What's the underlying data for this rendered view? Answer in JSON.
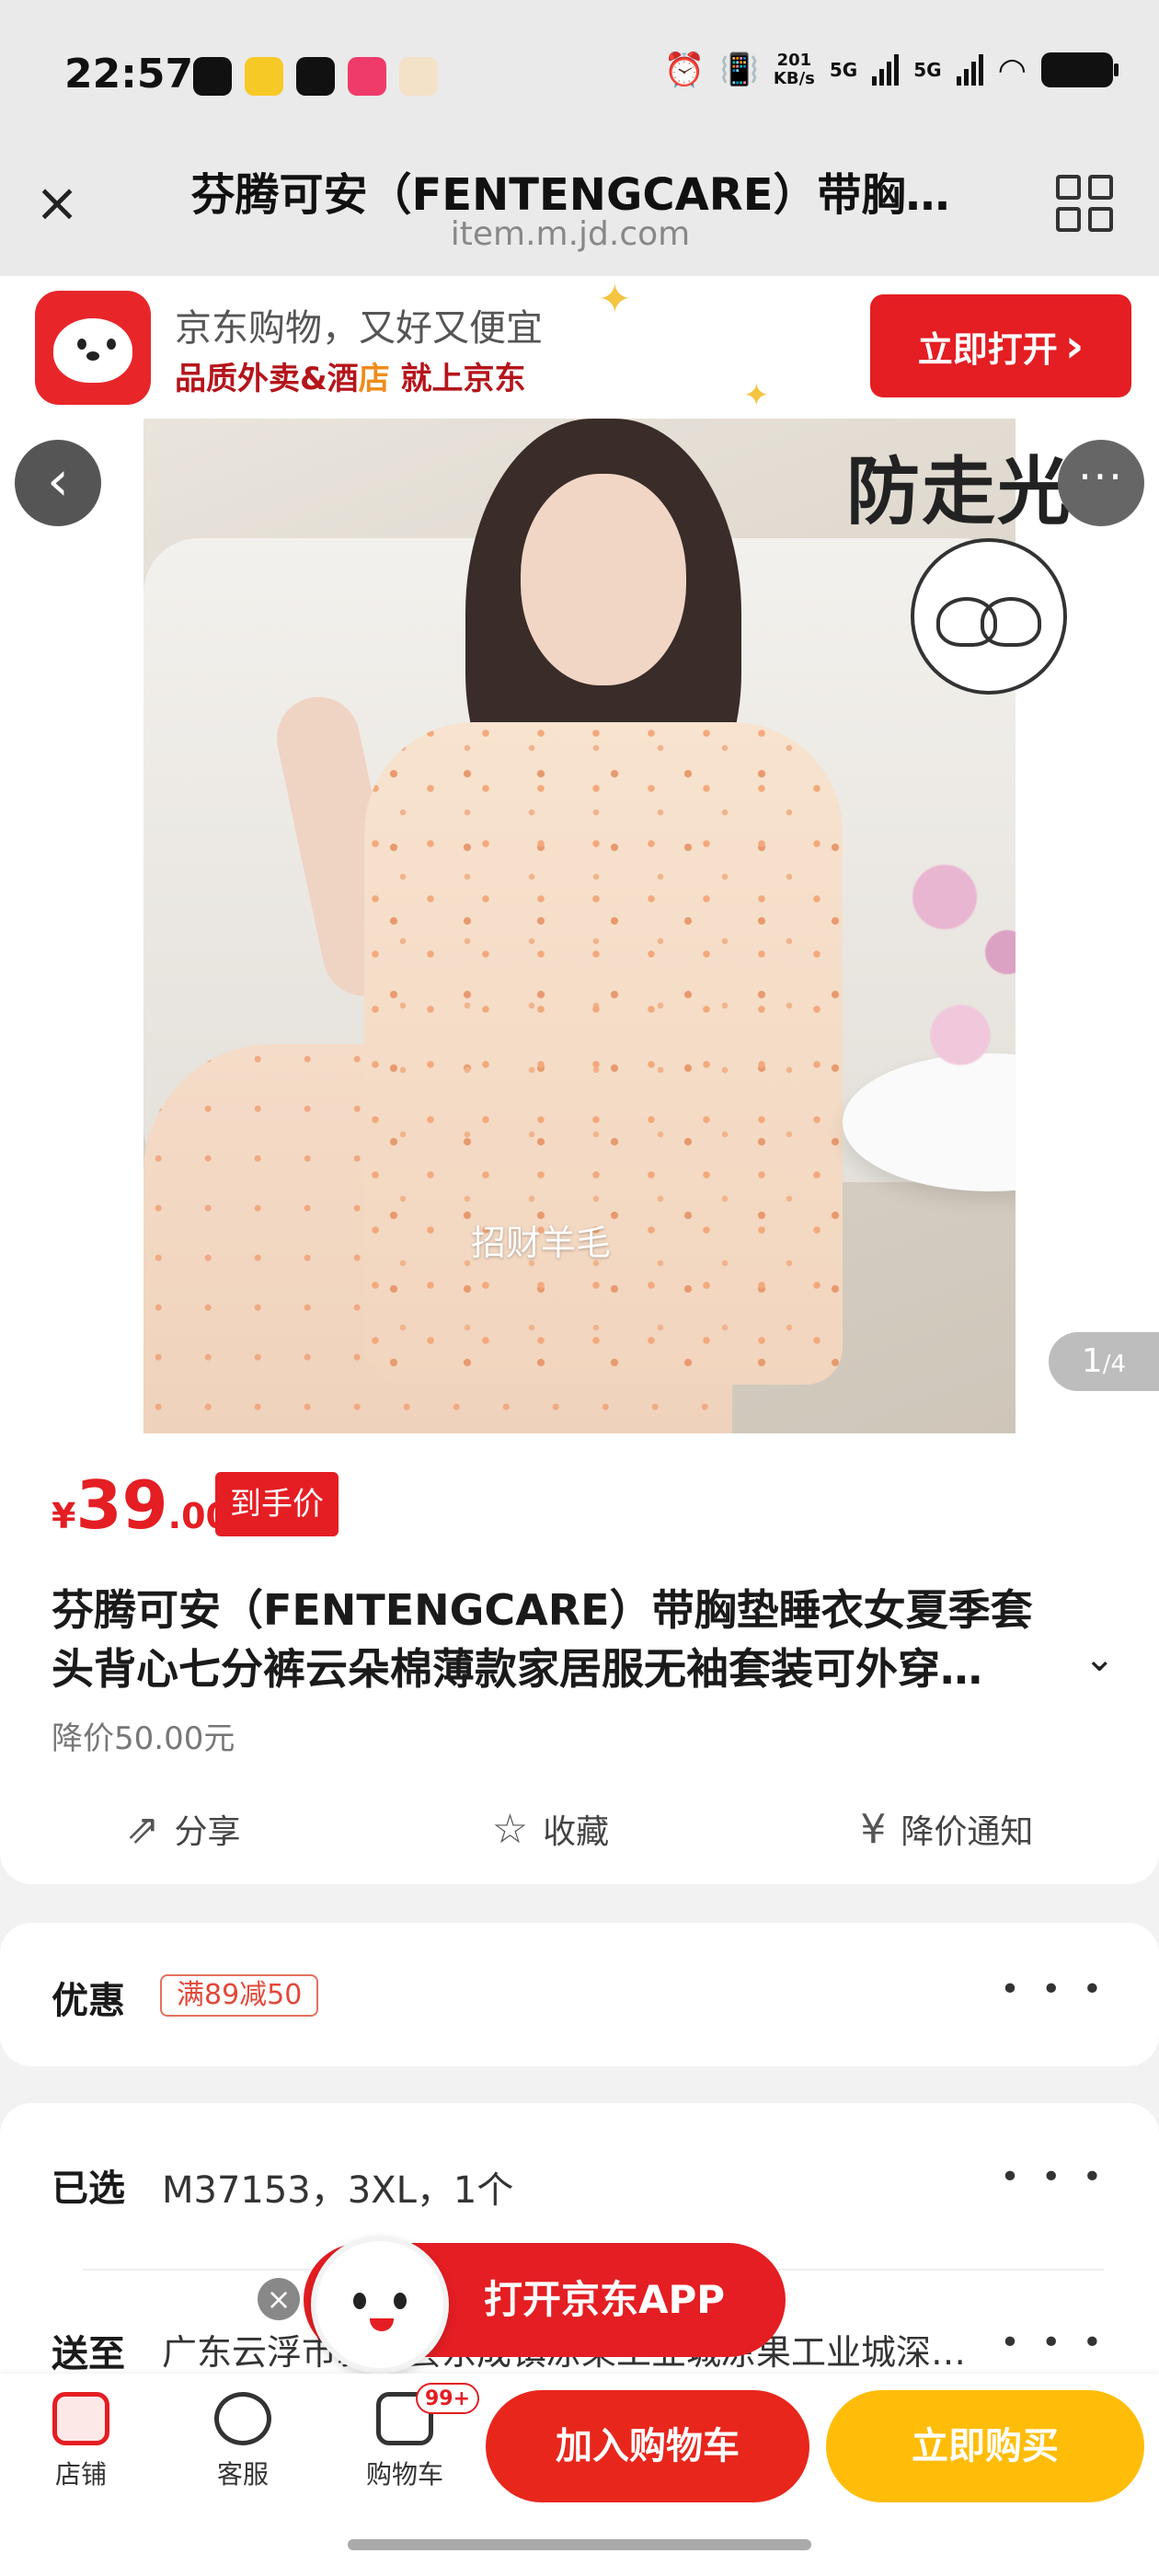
{
  "status": {
    "time": "22:57",
    "net_speed_value": "201",
    "net_speed_unit": "KB/s",
    "sim1": "5G",
    "sim2": "5G"
  },
  "browser": {
    "title": "芬腾可安（FENTENGCARE）带胸…",
    "url": "item.m.jd.com"
  },
  "banner": {
    "line1": "京东购物，又好又便宜",
    "line2_a": "品质外卖&酒",
    "line2_b": "店",
    "line2_c": " 就上京东",
    "open_label": "立即打开",
    "open_chevron": "›"
  },
  "gallery": {
    "ad_text": "防走光",
    "watermark": "招财羊毛",
    "pager_current": "1",
    "pager_total": "/4"
  },
  "product": {
    "currency": "¥",
    "price_int": "39",
    "price_dec": ".00",
    "price_tag": "到手价",
    "title_line1": "芬腾可安（FENTENGCARE）带胸垫睡衣女夏季套",
    "title_line2": "头背心七分裤云朵棉薄款家居服无袖套装可外穿…",
    "drop_note": "降价50.00元",
    "actions": {
      "share": "分享",
      "favorite": "收藏",
      "price_alert": "降价通知"
    }
  },
  "promo": {
    "label": "优惠",
    "coupon": "满89减50",
    "more": "• • •"
  },
  "selection": {
    "label": "已选",
    "value": "M37153，3XL，1个",
    "ship_label": "送至",
    "address": "广东云浮市新兴县东成镇凉果工业城凉果工业城深…",
    "more": "• • •"
  },
  "float_app": {
    "label": "打开京东APP",
    "close": "×"
  },
  "bottom_bar": {
    "shop": "店铺",
    "service": "客服",
    "cart": "购物车",
    "cart_badge": "99+",
    "add_to_cart": "加入购物车",
    "buy_now": "立即购买"
  },
  "colors": {
    "jd_red": "#e41e23",
    "buy_yellow": "#ffbd0a",
    "coupon_red": "#e4473a"
  },
  "icons": [
    "close-icon",
    "grid-icon",
    "back-icon",
    "more-icon",
    "share-icon",
    "star-icon",
    "price-alert-icon",
    "shop-icon",
    "service-icon",
    "cart-icon"
  ]
}
